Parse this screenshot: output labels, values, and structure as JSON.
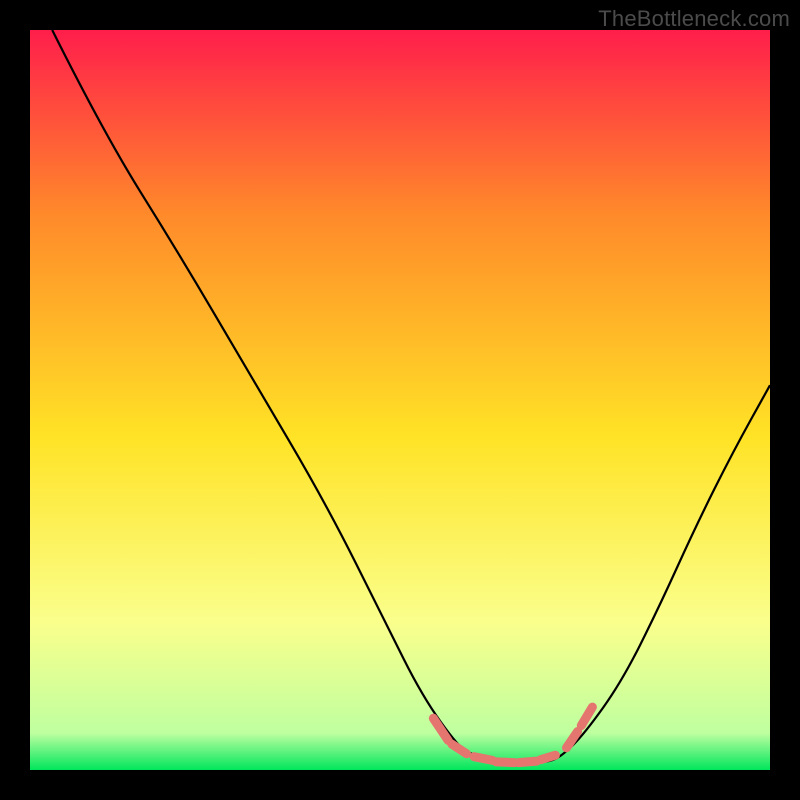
{
  "watermark": "TheBottleneck.com",
  "chart_data": {
    "type": "line",
    "title": "",
    "xlabel": "",
    "ylabel": "",
    "xlim": [
      0,
      100
    ],
    "ylim": [
      0,
      100
    ],
    "grid": false,
    "gradient_stops": [
      {
        "offset": 0.0,
        "color": "#FF1E4B"
      },
      {
        "offset": 0.25,
        "color": "#FF8A2A"
      },
      {
        "offset": 0.55,
        "color": "#FFE326"
      },
      {
        "offset": 0.8,
        "color": "#FAFF8C"
      },
      {
        "offset": 0.95,
        "color": "#BFFFA0"
      },
      {
        "offset": 1.0,
        "color": "#00E65C"
      }
    ],
    "series": [
      {
        "name": "bottleneck-curve",
        "color": "#000000",
        "x": [
          3,
          10,
          20,
          30,
          40,
          48,
          53,
          58,
          60,
          65,
          70,
          72,
          75,
          80,
          85,
          90,
          95,
          100
        ],
        "values": [
          100,
          86,
          70,
          53,
          36,
          20,
          10,
          3,
          2,
          1,
          1,
          2,
          5,
          12,
          22,
          33,
          43,
          52
        ]
      }
    ],
    "markers": {
      "name": "odd-chunks",
      "color": "#E5766F",
      "segments": [
        {
          "x1": 54.5,
          "y1": 7.0,
          "x2": 56.5,
          "y2": 4.0
        },
        {
          "x1": 57.0,
          "y1": 3.5,
          "x2": 59.0,
          "y2": 2.2
        },
        {
          "x1": 60.0,
          "y1": 1.8,
          "x2": 62.5,
          "y2": 1.3
        },
        {
          "x1": 63.0,
          "y1": 1.1,
          "x2": 65.5,
          "y2": 1.0
        },
        {
          "x1": 66.0,
          "y1": 1.0,
          "x2": 68.5,
          "y2": 1.2
        },
        {
          "x1": 69.0,
          "y1": 1.4,
          "x2": 71.0,
          "y2": 2.0
        },
        {
          "x1": 72.5,
          "y1": 3.0,
          "x2": 74.0,
          "y2": 5.2
        },
        {
          "x1": 74.5,
          "y1": 6.0,
          "x2": 76.0,
          "y2": 8.5
        }
      ]
    }
  }
}
